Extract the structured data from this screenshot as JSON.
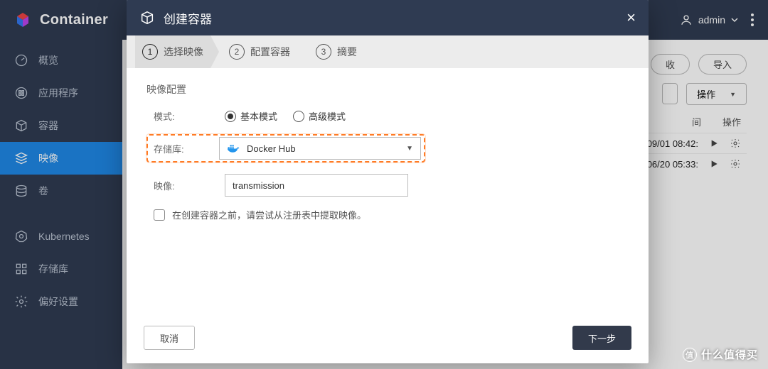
{
  "brand": {
    "title": "Container"
  },
  "user": {
    "name": "admin"
  },
  "sidebar": {
    "items": [
      {
        "label": "概览"
      },
      {
        "label": "应用程序"
      },
      {
        "label": "容器"
      },
      {
        "label": "映像"
      },
      {
        "label": "卷"
      },
      {
        "label": "Kubernetes"
      },
      {
        "label": "存储库"
      },
      {
        "label": "偏好设置"
      }
    ]
  },
  "toolbar": {
    "retrieve_label": "收",
    "import_label": "导入",
    "action_label": "操作"
  },
  "table": {
    "col_time": "间",
    "col_action": "操作",
    "rows": [
      {
        "time": "09/01 08:42:"
      },
      {
        "time": "06/20 05:33:"
      }
    ]
  },
  "modal": {
    "title": "创建容器",
    "steps": [
      {
        "label": "选择映像"
      },
      {
        "label": "配置容器"
      },
      {
        "label": "摘要"
      }
    ],
    "section_title": "映像配置",
    "mode": {
      "label": "模式:",
      "options": {
        "basic": "基本模式",
        "advanced": "高级模式"
      },
      "selected": "basic"
    },
    "repo": {
      "label": "存储库:",
      "value": "Docker Hub"
    },
    "image": {
      "label": "映像:",
      "value": "transmission"
    },
    "pull_hint": "在创建容器之前，请尝试从注册表中提取映像。",
    "cancel": "取消",
    "next": "下一步"
  },
  "watermark": "什么值得买"
}
